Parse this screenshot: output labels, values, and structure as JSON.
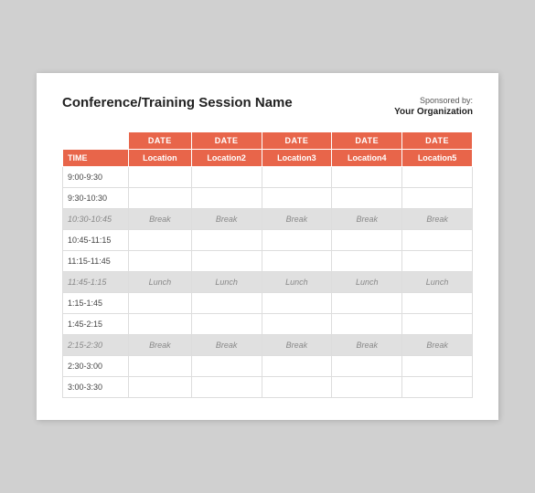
{
  "header": {
    "title": "Conference/Training Session Name",
    "sponsor_label": "Sponsored by:",
    "sponsor_name": "Your Organization"
  },
  "table": {
    "date_row": {
      "empty_label": "",
      "col1": "DATE",
      "col2": "DATE",
      "col3": "DATE",
      "col4": "DATE",
      "col5": "DATE"
    },
    "location_row": {
      "time_header": "TIME",
      "loc1": "Location",
      "loc2": "Location2",
      "loc3": "Location3",
      "loc4": "Location4",
      "loc5": "Location5"
    },
    "rows": [
      {
        "type": "normal",
        "time": "9:00-9:30",
        "c1": "",
        "c2": "",
        "c3": "",
        "c4": "",
        "c5": ""
      },
      {
        "type": "normal",
        "time": "9:30-10:30",
        "c1": "",
        "c2": "",
        "c3": "",
        "c4": "",
        "c5": ""
      },
      {
        "type": "break",
        "time": "10:30-10:45",
        "c1": "Break",
        "c2": "Break",
        "c3": "Break",
        "c4": "Break",
        "c5": "Break"
      },
      {
        "type": "normal",
        "time": "10:45-11:15",
        "c1": "",
        "c2": "",
        "c3": "",
        "c4": "",
        "c5": ""
      },
      {
        "type": "normal",
        "time": "11:15-11:45",
        "c1": "",
        "c2": "",
        "c3": "",
        "c4": "",
        "c5": ""
      },
      {
        "type": "break",
        "time": "11:45-1:15",
        "c1": "Lunch",
        "c2": "Lunch",
        "c3": "Lunch",
        "c4": "Lunch",
        "c5": "Lunch"
      },
      {
        "type": "normal",
        "time": "1:15-1:45",
        "c1": "",
        "c2": "",
        "c3": "",
        "c4": "",
        "c5": ""
      },
      {
        "type": "normal",
        "time": "1:45-2:15",
        "c1": "",
        "c2": "",
        "c3": "",
        "c4": "",
        "c5": ""
      },
      {
        "type": "break",
        "time": "2:15-2:30",
        "c1": "Break",
        "c2": "Break",
        "c3": "Break",
        "c4": "Break",
        "c5": "Break"
      },
      {
        "type": "normal",
        "time": "2:30-3:00",
        "c1": "",
        "c2": "",
        "c3": "",
        "c4": "",
        "c5": ""
      },
      {
        "type": "normal",
        "time": "3:00-3:30",
        "c1": "",
        "c2": "",
        "c3": "",
        "c4": "",
        "c5": ""
      }
    ]
  }
}
